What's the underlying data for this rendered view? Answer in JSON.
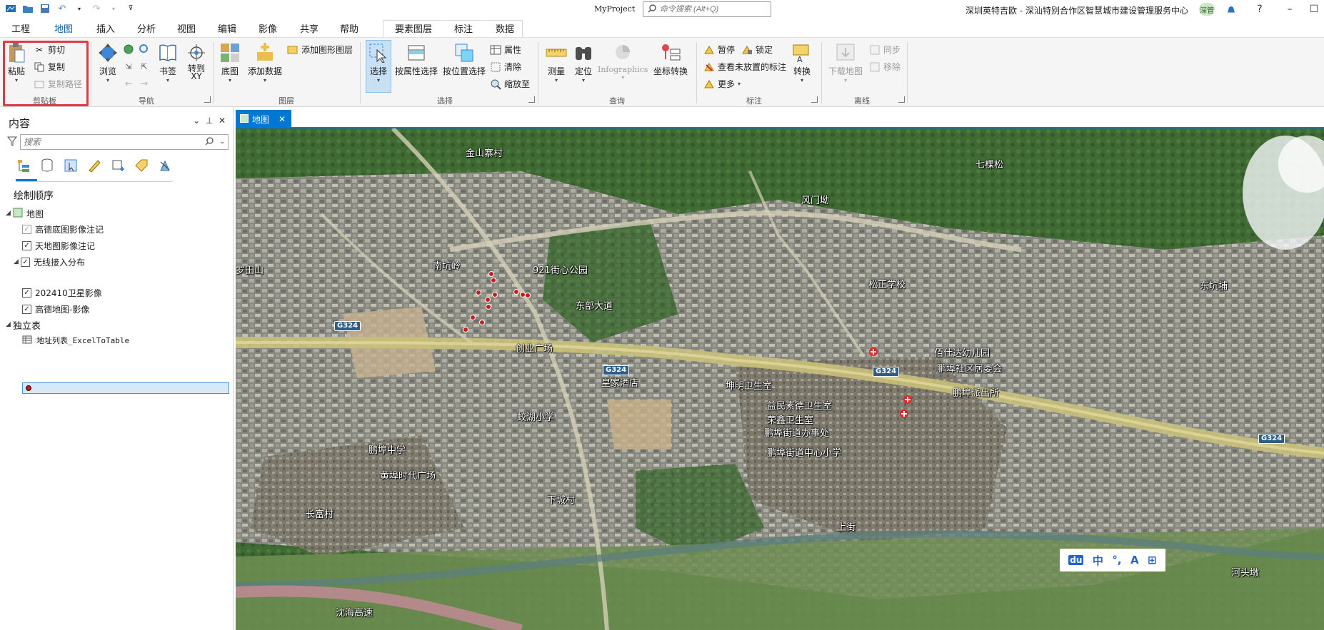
{
  "titlebar": {
    "project_name": "MyProject",
    "command_search_placeholder": "命令搜索 (Alt+Q)",
    "account": "深圳英特吉欧 - 深汕特别合作区智慧城市建设管理服务中心",
    "avatar": "深管"
  },
  "tabs": [
    "工程",
    "地图",
    "插入",
    "分析",
    "视图",
    "编辑",
    "影像",
    "共享",
    "帮助"
  ],
  "active_tab": "地图",
  "context_tabs": [
    "要素图层",
    "标注",
    "数据"
  ],
  "ribbon": {
    "clipboard": {
      "paste": "粘贴",
      "cut": "剪切",
      "copy": "复制",
      "copy_path": "复制路径",
      "group": "剪贴板"
    },
    "navigate": {
      "explore": "浏览",
      "bookmarks": "书签",
      "go_to_xy": "转到\nXY",
      "group": "导航"
    },
    "layer": {
      "basemap": "底图",
      "add_data": "添加数据",
      "add_graphics_layer": "添加图形图层",
      "group": "图层"
    },
    "selection": {
      "select": "选择",
      "select_by_attributes": "按属性选择",
      "select_by_location": "按位置选择",
      "attributes": "属性",
      "clear": "清除",
      "zoom_to": "缩放至",
      "group": "选择"
    },
    "inquiry": {
      "measure": "测量",
      "locate": "定位",
      "infographics": "Infographics",
      "coordinate_conversion": "坐标转换",
      "group": "查询"
    },
    "labeling": {
      "pause": "暂停",
      "lock": "锁定",
      "view_unplaced": "查看未放置的标注",
      "more": "更多",
      "convert": "转换",
      "group": "标注"
    },
    "offline": {
      "download_map": "下载地图",
      "sync": "同步",
      "remove": "移除",
      "group": "离线"
    }
  },
  "contents": {
    "title": "内容",
    "search_placeholder": "搜索",
    "drawing_order": "绘制顺序",
    "map_name": "地图",
    "layers": [
      {
        "name": "高德底图影像注记",
        "checked": true,
        "enabled": false
      },
      {
        "name": "天地图影像注记",
        "checked": true,
        "enabled": true
      },
      {
        "name": "无线接入分布",
        "checked": true,
        "enabled": true
      },
      {
        "name": "202410卫星影像",
        "checked": true,
        "enabled": true
      },
      {
        "name": "高德地图-影像",
        "checked": true,
        "enabled": true
      }
    ],
    "standalone_tables_heading": "独立表",
    "standalone_table": "地址列表_ExcelToTable"
  },
  "map_tab": "地图",
  "map_labels": [
    "金山寨村",
    "七棵松",
    "风门坳",
    "罗田山",
    "南坑岭",
    "921街心公园",
    "松正学校",
    "东坑埔",
    "东部大道",
    "创业广场",
    "佰仕达幼儿园",
    "鹏埠社区居委会",
    "皇家酒店",
    "坤明卫生室",
    "鹏埠派出所",
    "益民素德卫生室",
    "荣鑫卫生室",
    "鹏埠街道办事处",
    "鹏埠街道中心小学",
    "蛟湖小学",
    "下城村",
    "上街",
    "长富村",
    "河头墩",
    "沈海高速",
    "鹏埠中学",
    "黄埠时代广场"
  ],
  "road_shields": [
    "G324",
    "G324",
    "G324",
    "G324"
  ],
  "map_widget": [
    "du",
    "中",
    "°,",
    "A",
    "⊞"
  ]
}
